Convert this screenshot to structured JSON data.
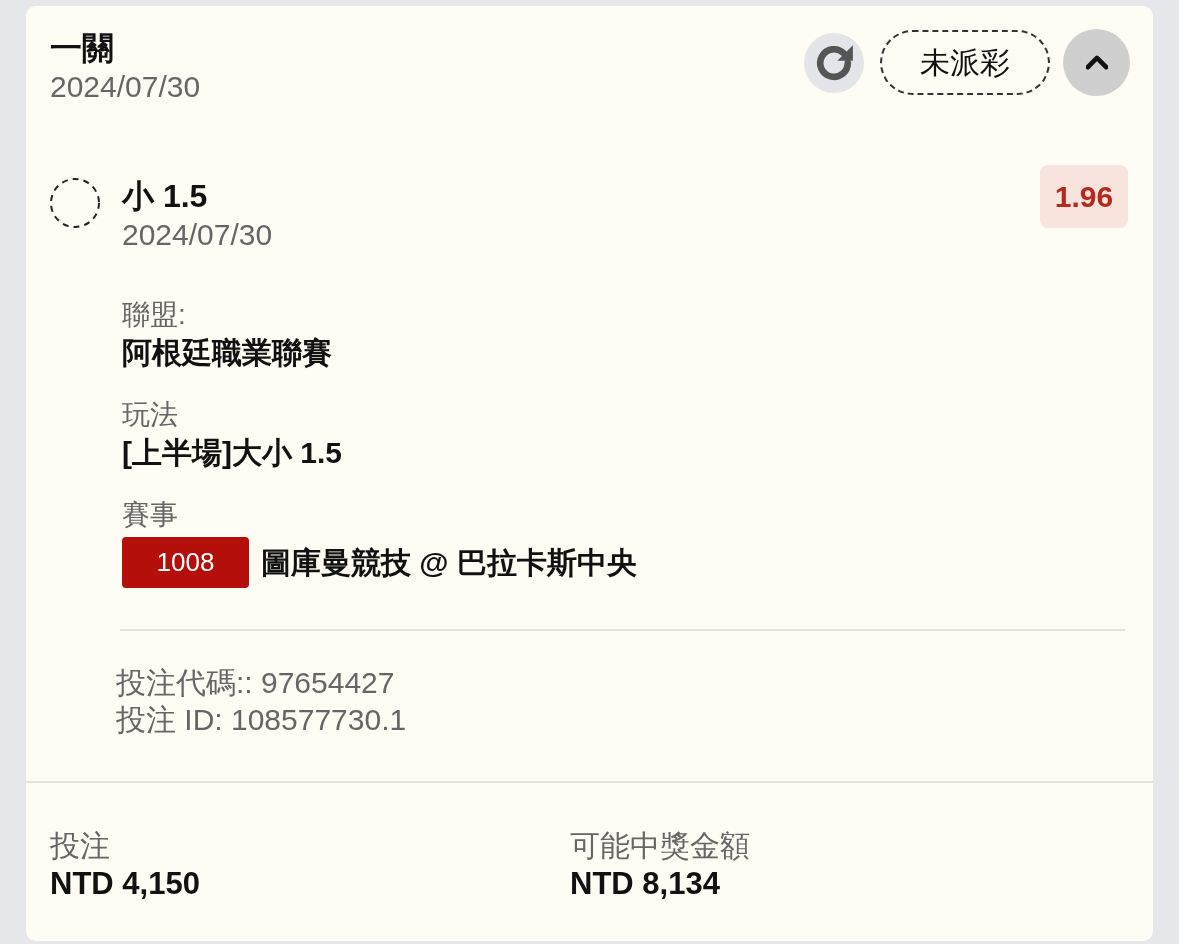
{
  "bet": {
    "title": "一關",
    "date": "2024/07/30",
    "status": "未派彩",
    "expanded": true
  },
  "selection": {
    "name": "小 1.5",
    "date": "2024/07/30",
    "odds": "1.96"
  },
  "details": [
    {
      "kind": "text",
      "label": "聯盟:",
      "value": "阿根廷職業聯賽"
    },
    {
      "kind": "text",
      "label": "玩法",
      "value": "[上半場]大小 1.5"
    },
    {
      "kind": "event",
      "label": "賽事",
      "event_code": "1008",
      "value": "圖庫曼競技 @ 巴拉卡斯中央"
    }
  ],
  "references": [
    "投注代碼:: 97654427",
    "投注 ID: 108577730.1"
  ],
  "totals": [
    {
      "label": "投注",
      "amount": "NTD 4,150"
    },
    {
      "label": "可能中獎金額",
      "amount": "NTD 8,134"
    }
  ]
}
